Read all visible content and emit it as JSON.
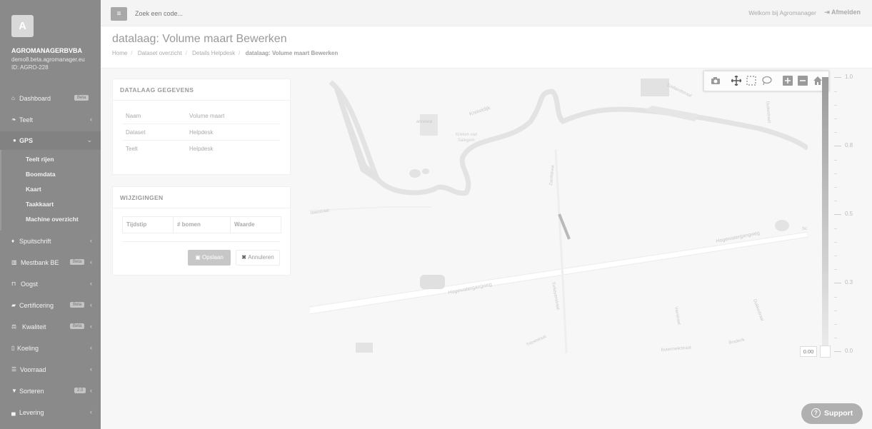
{
  "sidebar": {
    "avatar_letter": "A",
    "org_name": "AGROMANAGERBVBA",
    "domain": "demo8.beta.agromanager.eu",
    "id": "ID: AGRO-228",
    "items": [
      {
        "icon": "home-icon",
        "label": "Dashboard",
        "badge": "Beta"
      },
      {
        "icon": "leaf-icon",
        "label": "Teelt"
      },
      {
        "icon": "map-marker-icon",
        "label": "GPS"
      },
      {
        "icon": "tint-icon",
        "label": "Spuitschrift"
      },
      {
        "icon": "bank-icon",
        "label": "Mestbank BE",
        "badge": "Beta"
      },
      {
        "icon": "basket-icon",
        "label": "Oogst"
      },
      {
        "icon": "certificate-icon",
        "label": "Certificering",
        "badge": "Beta"
      },
      {
        "icon": "balance-icon",
        "label": "Kwaliteit",
        "badge": "Beta"
      },
      {
        "icon": "thermometer-icon",
        "label": "Koeling"
      },
      {
        "icon": "list-icon",
        "label": "Voorraad"
      },
      {
        "icon": "filter-icon",
        "label": "Sorteren",
        "badge": "2.0"
      },
      {
        "icon": "truck-icon",
        "label": "Levering"
      }
    ],
    "gps_sub": [
      "Teelt rijen",
      "Boomdata",
      "Kaart",
      "Taakkaart",
      "Machine overzicht"
    ]
  },
  "topbar": {
    "search_placeholder": "Zoek een code...",
    "welcome": "Welkom bij Agromanager",
    "logout": "Afmelden"
  },
  "page": {
    "title": "datalaag: Volume maart Bewerken",
    "breadcrumb": [
      "Home",
      "Dataset overzicht",
      "Details Helpdesk",
      "datalaag: Volume maart Bewerken"
    ]
  },
  "details_panel": {
    "title": "DATALAAG GEGEVENS",
    "rows": [
      {
        "key": "Naam",
        "value": "Volume maart"
      },
      {
        "key": "Dataset",
        "value": "Helpdesk"
      },
      {
        "key": "Teelt",
        "value": "Helpdesk"
      }
    ]
  },
  "changes_panel": {
    "title": "WIJZIGINGEN",
    "columns": [
      "Tijdstip",
      "# bomen",
      "Waarde"
    ],
    "save_label": "Opslaan",
    "cancel_label": "Annuleren"
  },
  "map": {
    "labels": [
      "Krekeldijk",
      "Kreken van Saeghem",
      "Zuidlandstraat",
      "Zandstraat",
      "Hogewatergangweg",
      "Turkeyenstraat",
      "Trieststraat",
      "Butermelkstraat",
      "Braderik",
      "Vierstraat",
      "Dukkestraat",
      "Duikestraat",
      "Ruitestraat",
      "annewal",
      "taasstraat",
      "Sc"
    ]
  },
  "map_toolbar": [
    "camera-icon",
    "pan-icon",
    "box-select-icon",
    "lasso-icon",
    "zoom-in-icon",
    "zoom-out-icon",
    "reset-home-icon"
  ],
  "colorscale": {
    "ticks": [
      "1.0",
      "0.8",
      "0.5",
      "0.3",
      "0.0"
    ],
    "value": "0.00"
  },
  "support": {
    "label": "Support"
  },
  "colors": {
    "sidebar": "#8a8a8a",
    "overlay": "#f7f7f7"
  }
}
